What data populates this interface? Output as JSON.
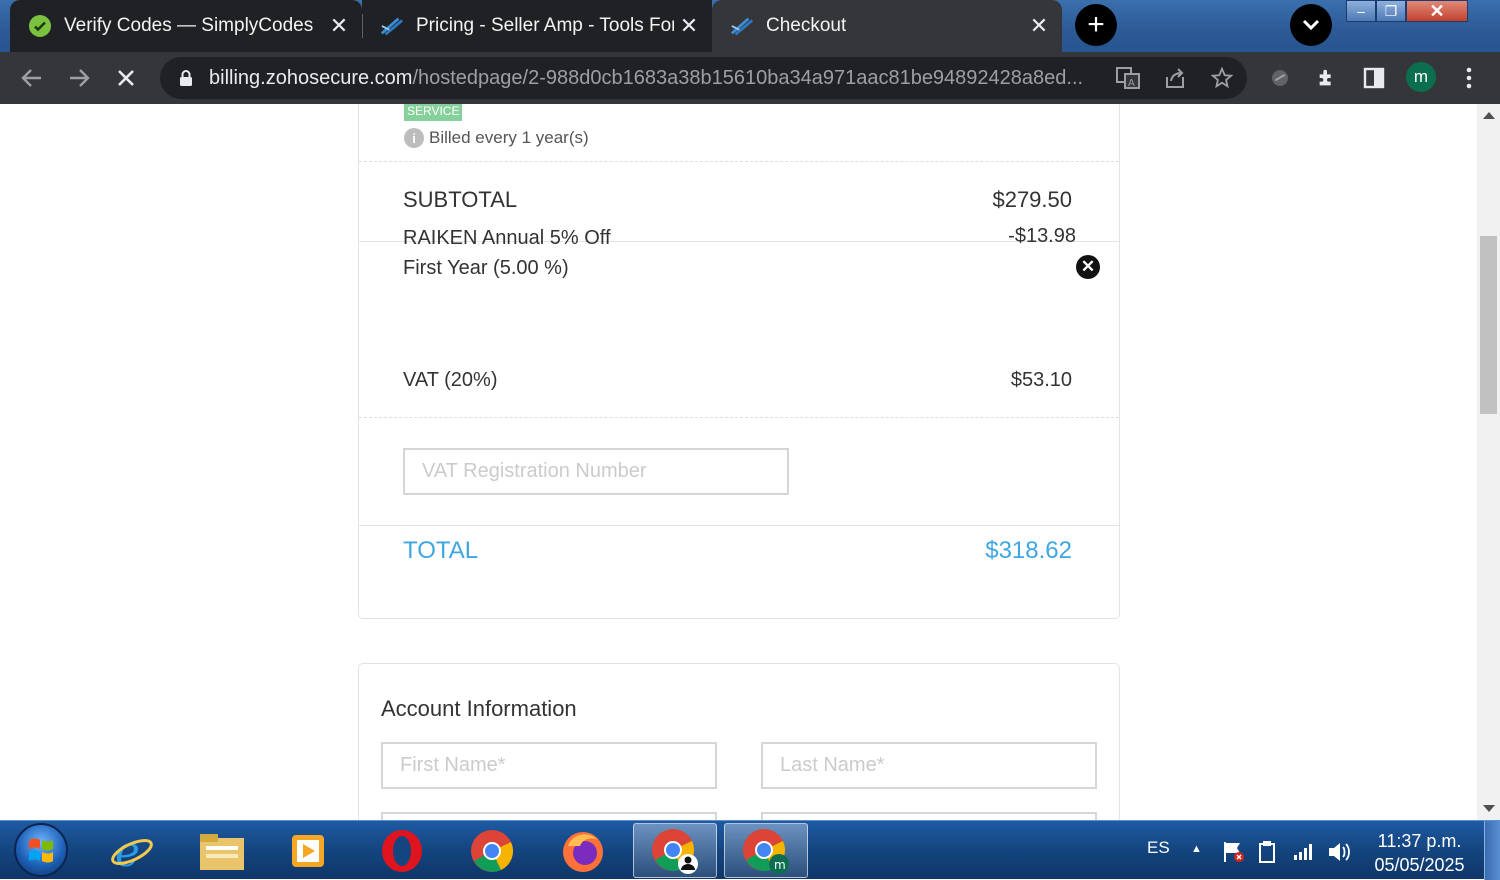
{
  "browser": {
    "tabs": [
      {
        "title": "Verify Codes — SimplyCodes",
        "favicon": "simplycodes-icon",
        "state": "inactive"
      },
      {
        "title": "Pricing - Seller Amp - Tools For A",
        "favicon": "selleramp-icon",
        "state": "inactive"
      },
      {
        "title": "Checkout",
        "favicon": "selleramp-icon",
        "state": "active"
      }
    ],
    "new_tab_glyph": "+",
    "close_glyph": "✕",
    "url_host": "billing.zohosecure.com",
    "url_path": "/hostedpage/2-988d0cb1683a38b15610ba34a971aac81be94892428a8ed...",
    "profile_initial": "m",
    "window_controls": {
      "minimize": "–",
      "maximize": "❐",
      "close": "✕"
    }
  },
  "order_summary": {
    "plan_badge": "SERVICE",
    "billing_cycle": "Billed every 1 year(s)",
    "info_glyph": "i",
    "subtotal_label": "SUBTOTAL",
    "subtotal_value": "$279.50",
    "discount_line1": "RAIKEN Annual 5% Off",
    "discount_line2": "First Year (5.00 %)",
    "discount_value": "-$13.98",
    "remove_glyph": "✕",
    "vat_label": "VAT (20%)",
    "vat_value": "$53.10",
    "vat_number_placeholder": "VAT Registration Number",
    "total_label": "TOTAL",
    "total_value": "$318.62",
    "accent_color": "#3ea6e0"
  },
  "account": {
    "title": "Account Information",
    "first_name_placeholder": "First Name*",
    "last_name_placeholder": "Last Name*"
  },
  "taskbar": {
    "apps": [
      "internet-explorer-icon",
      "file-explorer-icon",
      "media-player-icon",
      "opera-icon",
      "chrome-icon",
      "firefox-icon",
      "chrome-profile-icon",
      "chrome-m-profile-icon"
    ],
    "language": "ES",
    "tray_arrow": "▲",
    "time": "11:37 p.m.",
    "date": "05/05/2025"
  }
}
